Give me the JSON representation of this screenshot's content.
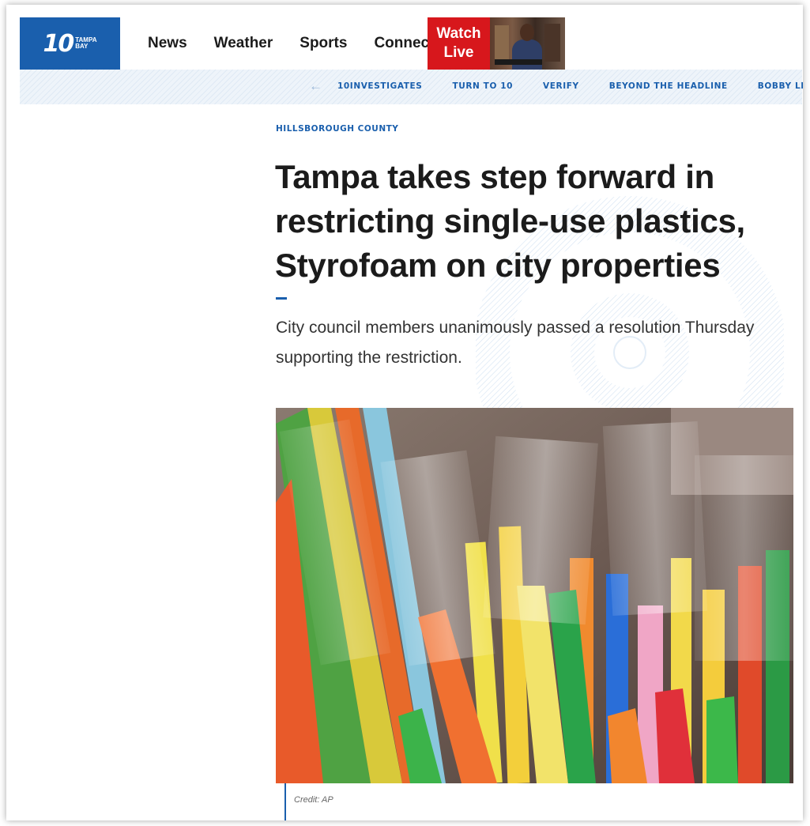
{
  "header": {
    "logo_number": "10",
    "logo_line1": "TAMPA",
    "logo_line2": "BAY",
    "nav": [
      "News",
      "Weather",
      "Sports",
      "Connect"
    ],
    "watch_live_line1": "Watch",
    "watch_live_line2": "Live"
  },
  "subnav": {
    "items": [
      "10INVESTIGATES",
      "TURN TO 10",
      "VERIFY",
      "BEYOND THE HEADLINE",
      "BOBBY LEWIS C"
    ]
  },
  "article": {
    "kicker": "HILLSBOROUGH COUNTY",
    "headline": "Tampa takes step forward in restricting single-use plastics, Styrofoam on city properties",
    "dek": "City council members unanimously passed a resolution Thursday supporting the restriction.",
    "credit": "Credit: AP"
  },
  "colors": {
    "brand_blue": "#1a5fad",
    "watch_red": "#d7171c"
  }
}
